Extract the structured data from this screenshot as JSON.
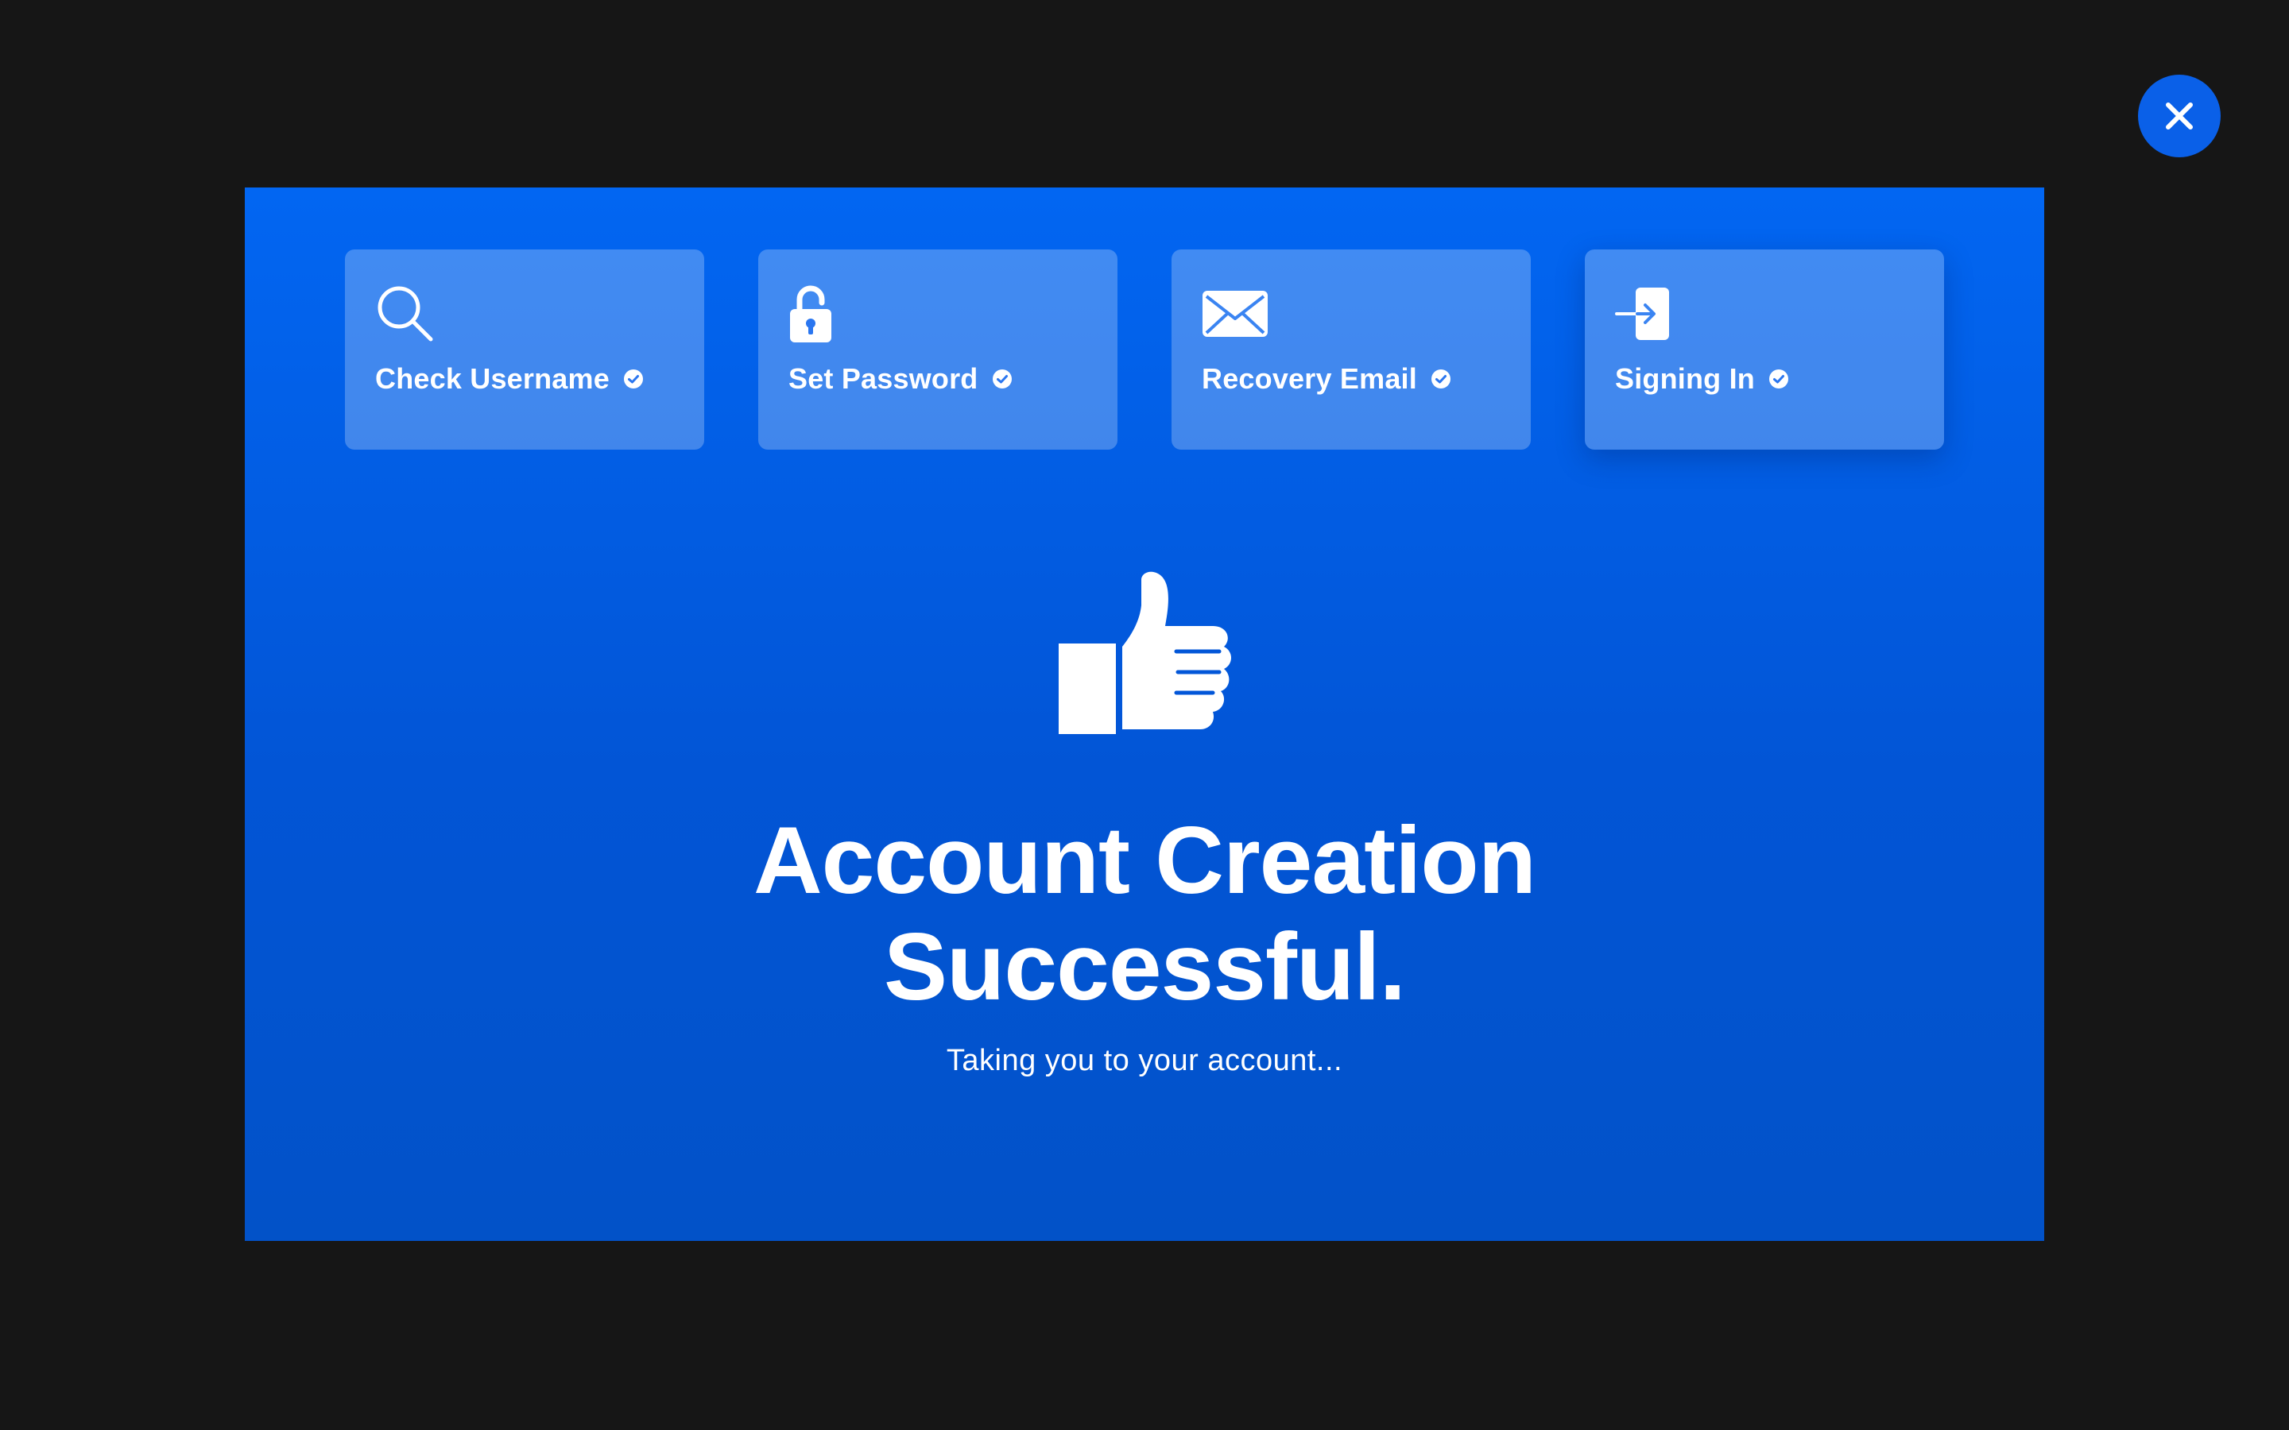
{
  "close_button": {
    "icon": "close-icon",
    "color": "#0a60e8"
  },
  "steps": [
    {
      "label": "Check Username",
      "icon": "search-icon",
      "status_icon": "check-circle-icon"
    },
    {
      "label": "Set Password",
      "icon": "lock-icon",
      "status_icon": "check-circle-icon"
    },
    {
      "label": "Recovery Email",
      "icon": "envelope-icon",
      "status_icon": "check-circle-icon"
    },
    {
      "label": "Signing In",
      "icon": "sign-in-icon",
      "status_icon": "check-circle-icon",
      "active": true
    }
  ],
  "main": {
    "icon": "thumbs-up-icon",
    "headline_line1": "Account Creation",
    "headline_line2": "Successful.",
    "subtext": "Taking you to your account..."
  },
  "colors": {
    "background": "#161616",
    "modal_top": "#0266f2",
    "modal_bottom": "#0252c8",
    "text": "#ffffff"
  }
}
